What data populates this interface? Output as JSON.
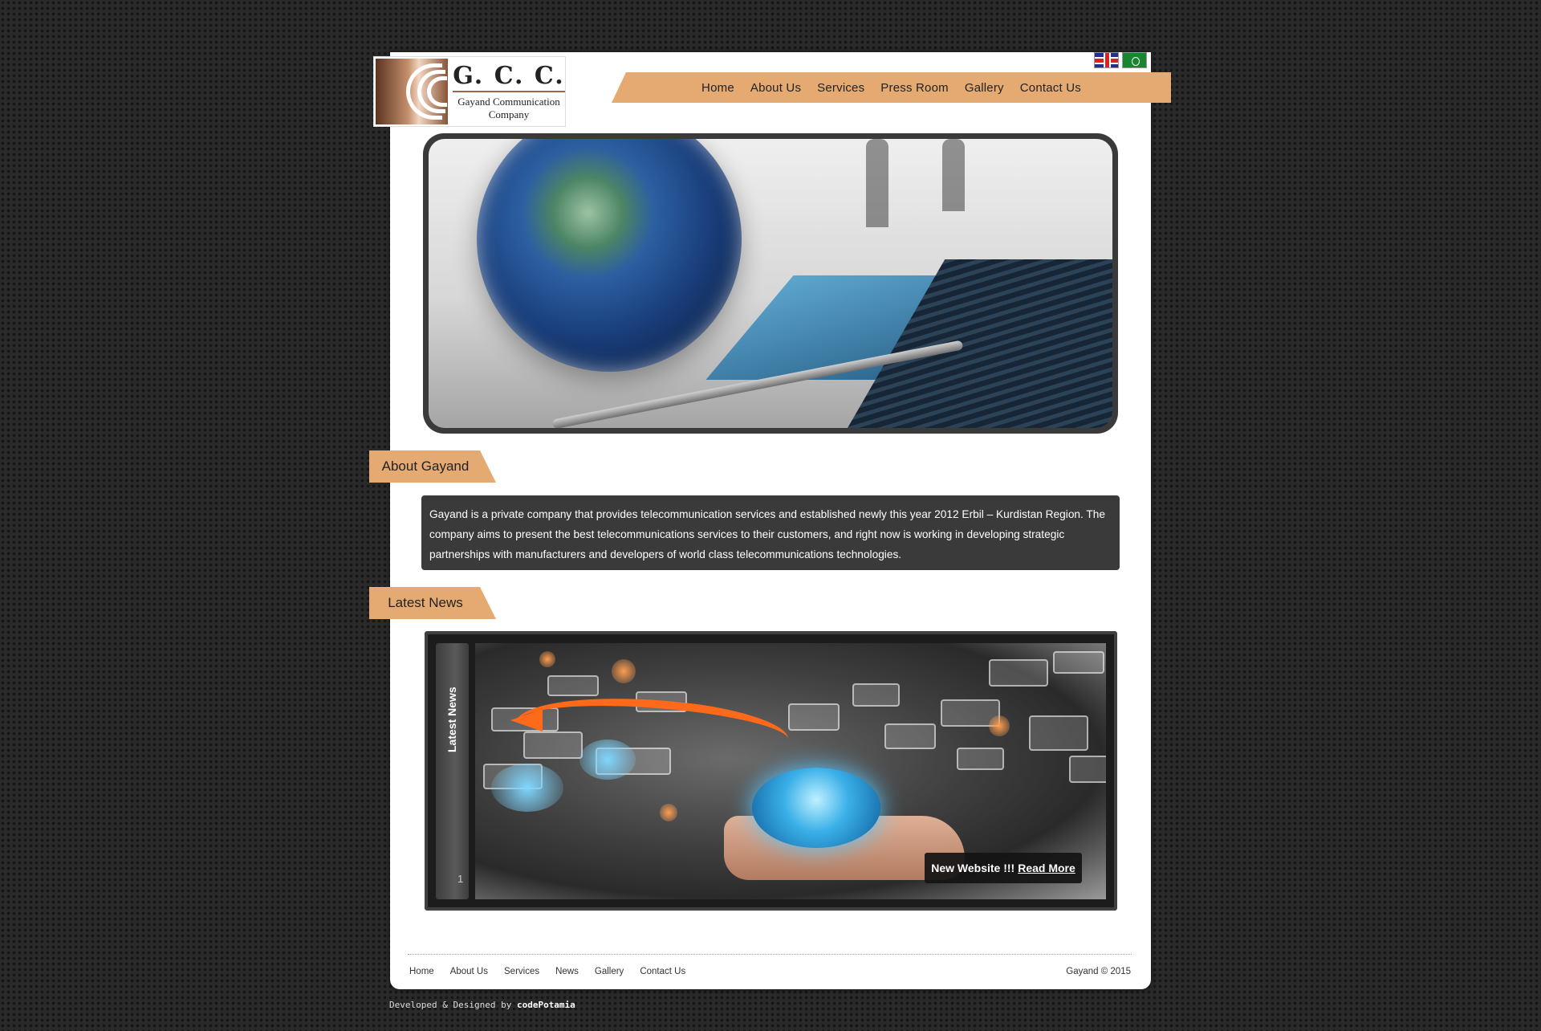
{
  "logo": {
    "title": "G. C. C.",
    "subtitle_line1": "Gayand Communication",
    "subtitle_line2": "Company"
  },
  "languages": [
    {
      "name": "English",
      "icon": "uk-flag-icon"
    },
    {
      "name": "Arabic",
      "icon": "arabic-flag-icon"
    }
  ],
  "nav": {
    "items": [
      "Home",
      "About Us",
      "Services",
      "Press Room",
      "Gallery",
      "Contact Us"
    ]
  },
  "about": {
    "heading": "About Gayand",
    "text": "Gayand is a private company that provides telecommunication services and established newly this year 2012 Erbil – Kurdistan Region. The company aims to present the best telecommunications services to their customers, and right now is working in developing strategic partnerships with manufacturers and developers of world class telecommunications technologies."
  },
  "news": {
    "heading": "Latest News",
    "side_label": "Latest News",
    "slide_number": "1",
    "caption": "New Website !!!",
    "read_more": "Read More"
  },
  "footer": {
    "links": [
      "Home",
      "About Us",
      "Services",
      "News",
      "Gallery",
      "Contact Us"
    ],
    "copyright": "Gayand © 2015",
    "credit_prefix": "Developed & Designed by",
    "credit_name": "codePotamia"
  },
  "colors": {
    "accent": "#e4aa72",
    "dark_panel": "#3a3a3a",
    "background": "#2a2a2a"
  }
}
